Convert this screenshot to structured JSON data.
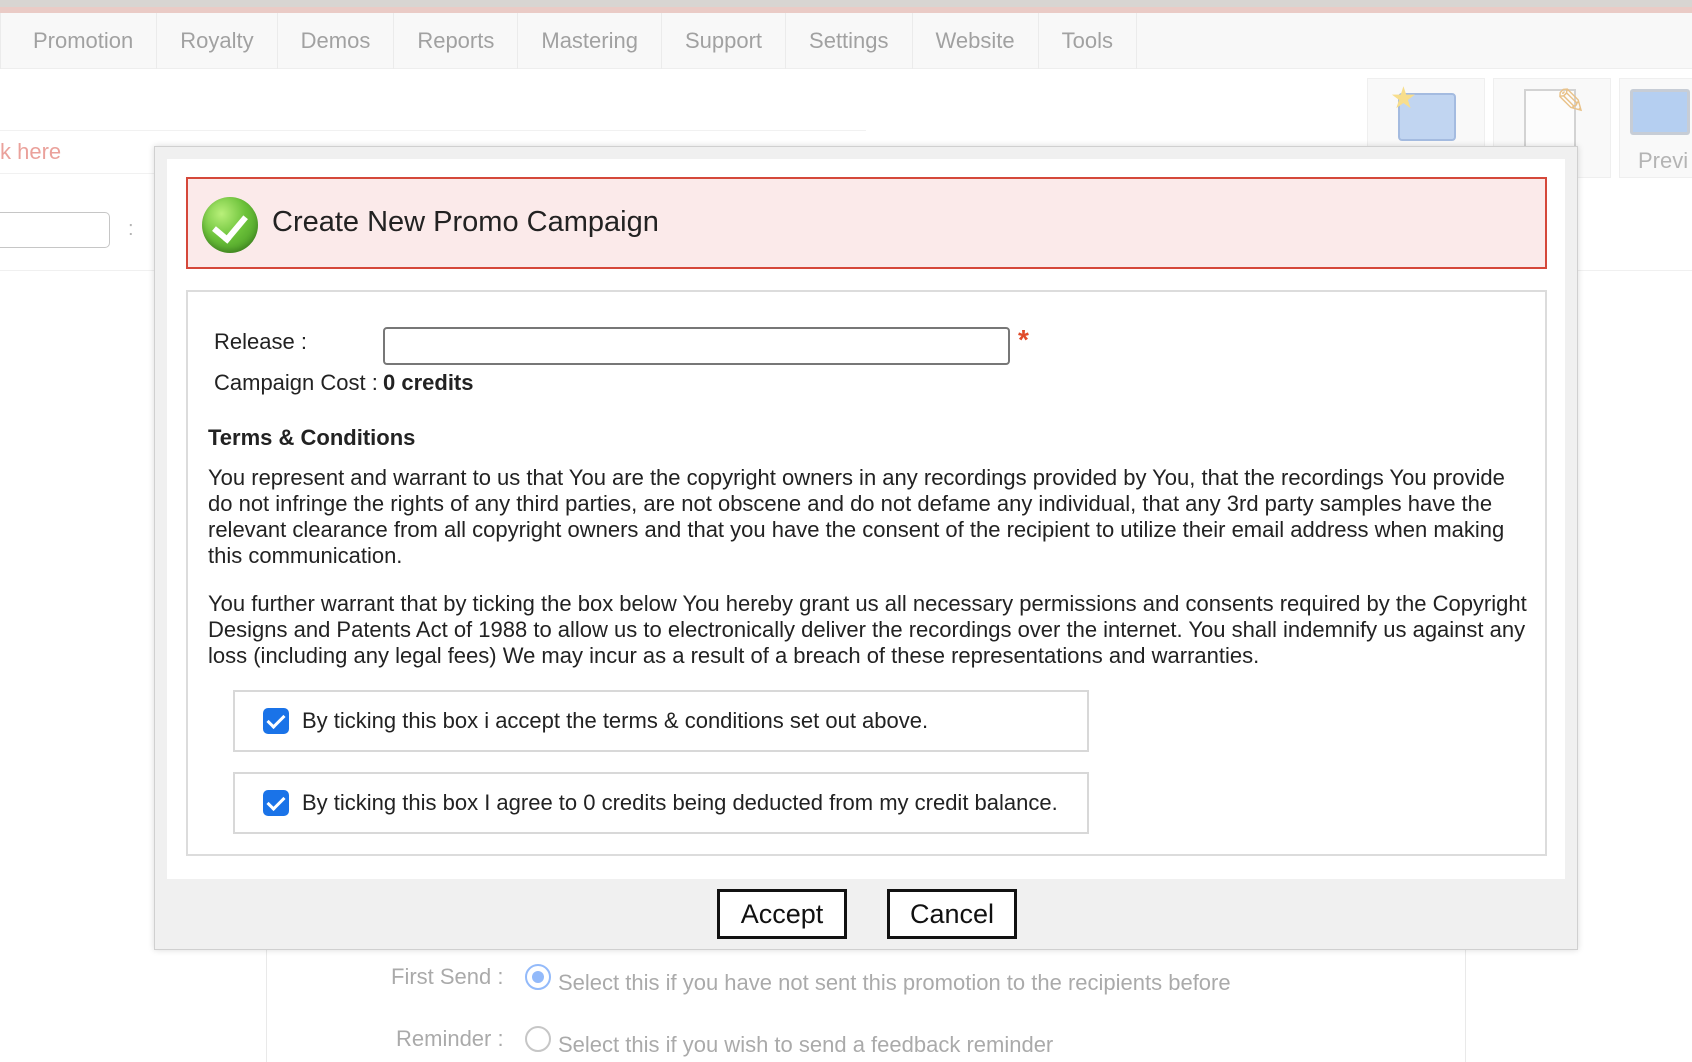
{
  "nav": {
    "items": [
      "Promotion",
      "Royalty",
      "Demos",
      "Reports",
      "Mastering",
      "Support",
      "Settings",
      "Website",
      "Tools"
    ]
  },
  "background": {
    "link_text": "k here",
    "colon": ":",
    "toolbar_label": "Previ",
    "first_send_label": "First Send :",
    "first_send_text": "Select this if you have not sent this promotion to the recipients before",
    "reminder_label": "Reminder :",
    "reminder_text": "Select this if you wish to send a feedback reminder"
  },
  "icons": {
    "header": "success-check-icon",
    "toolbar": [
      "new-folder-star-icon",
      "edit-notepad-icon",
      "preview-monitor-icon"
    ]
  },
  "colors": {
    "header_bg": "#fbeaea",
    "header_border": "#d5483a",
    "checkbox": "#1a73e8",
    "required": "#e04b2a"
  },
  "modal": {
    "title": "Create New Promo Campaign",
    "release_label": "Release :",
    "release_value": "",
    "required_mark": "*",
    "cost_label": "Campaign Cost :",
    "cost_value": "0 credits",
    "terms_title": "Terms & Conditions",
    "terms_p1": "You represent and warrant to us that You are the copyright owners in any recordings provided by You, that the recordings You provide do not infringe the rights of any third parties, are not obscene and do not defame any individual, that any 3rd party samples have the relevant clearance from all copyright owners and that you have the consent of the recipient to utilize their email address when making this communication.",
    "terms_p2": "You further warrant that by ticking the box below You hereby grant us all necessary permissions and consents required by the Copyright Designs and Patents Act of 1988 to allow us to electronically deliver the recordings over the internet. You shall indemnify us against any loss (including any legal fees) We may incur as a result of a breach of these representations and warranties.",
    "agree_terms": "By ticking this box i accept the terms & conditions set out above.",
    "agree_terms_checked": true,
    "agree_credits": "By ticking this box I agree to 0 credits being deducted from my credit balance.",
    "agree_credits_checked": true,
    "accept_label": "Accept",
    "cancel_label": "Cancel"
  }
}
